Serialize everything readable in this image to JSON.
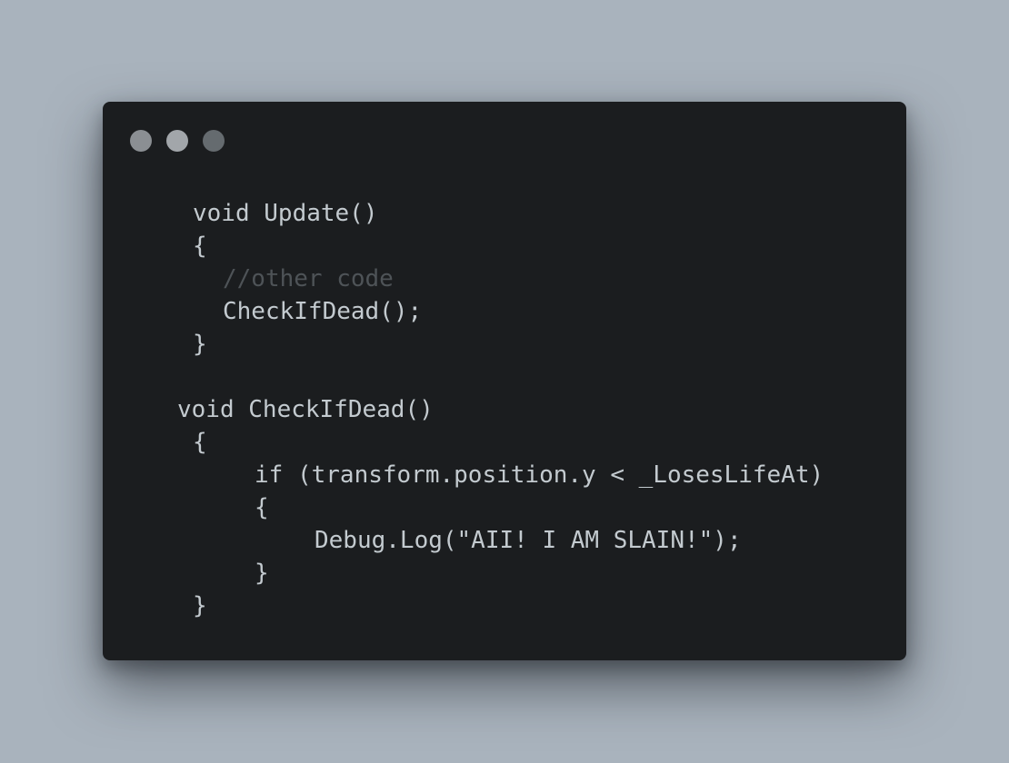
{
  "window": {
    "dots": [
      "control-dot",
      "control-dot",
      "control-dot"
    ]
  },
  "code": {
    "lines": [
      {
        "text": "void Update()"
      },
      {
        "text": "{"
      },
      {
        "text": "//other code"
      },
      {
        "text": "CheckIfDead();"
      },
      {
        "text": "}"
      },
      {
        "text": "void CheckIfDead()"
      },
      {
        "text": "{"
      },
      {
        "text": "if (transform.position.y < _LosesLifeAt)"
      },
      {
        "text": "{"
      },
      {
        "text": "Debug.Log(\"AII! I AM SLAIN!\");"
      },
      {
        "text": "}"
      },
      {
        "text": "}"
      }
    ]
  }
}
